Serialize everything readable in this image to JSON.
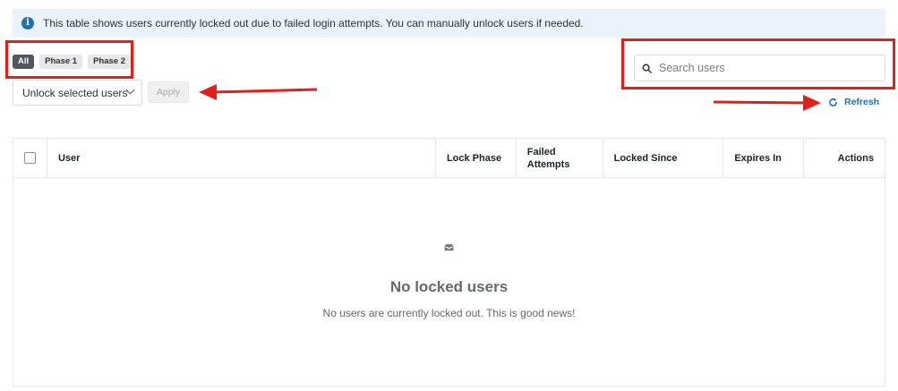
{
  "notice": {
    "icon": "info-icon",
    "text": "This table shows users currently locked out due to failed login attempts. You can manually unlock users if needed."
  },
  "filters": {
    "items": [
      {
        "label": "All",
        "active": true
      },
      {
        "label": "Phase 1",
        "active": false
      },
      {
        "label": "Phase 2",
        "active": false
      }
    ]
  },
  "bulk_actions": {
    "selected": "Unlock selected users",
    "apply_label": "Apply"
  },
  "search": {
    "placeholder": "Search users",
    "value": ""
  },
  "refresh": {
    "label": "Refresh"
  },
  "table": {
    "columns": [
      "User",
      "Lock Phase",
      "Failed Attempts",
      "Locked Since",
      "Expires In",
      "Actions"
    ],
    "rows": []
  },
  "empty_state": {
    "icon": "inbox-icon",
    "title": "No locked users",
    "message": "No users are currently locked out. This is good news!"
  },
  "colors": {
    "accent": "#2271b1",
    "annotation": "#e0201b",
    "notice_bg": "#eaf3fc"
  }
}
